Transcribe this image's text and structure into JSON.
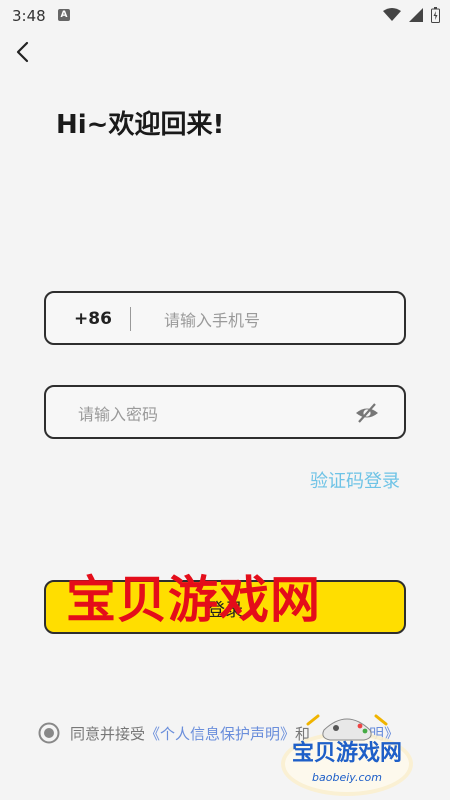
{
  "status_bar": {
    "time": "3:48",
    "notification_letter": "A"
  },
  "header": {
    "title": "Hi~欢迎回来!"
  },
  "phone_field": {
    "country_code": "+86",
    "placeholder": "请输入手机号",
    "value": ""
  },
  "password_field": {
    "placeholder": "请输入密码",
    "value": ""
  },
  "links": {
    "code_login": "验证码登录"
  },
  "login_button": {
    "label": "登录"
  },
  "agreement": {
    "prefix": "同意并接受",
    "privacy_link": "《个人信息保护声明》",
    "and": "和",
    "statement_link": "声明》"
  },
  "watermark": {
    "text": "宝贝游戏网",
    "logo_text": "宝贝游戏网",
    "logo_url": "baobeiy.com"
  },
  "colors": {
    "accent": "#ffde00",
    "link": "#6ec3e6",
    "agreement_link": "#6a8edb",
    "watermark_red": "#e40d1a"
  }
}
